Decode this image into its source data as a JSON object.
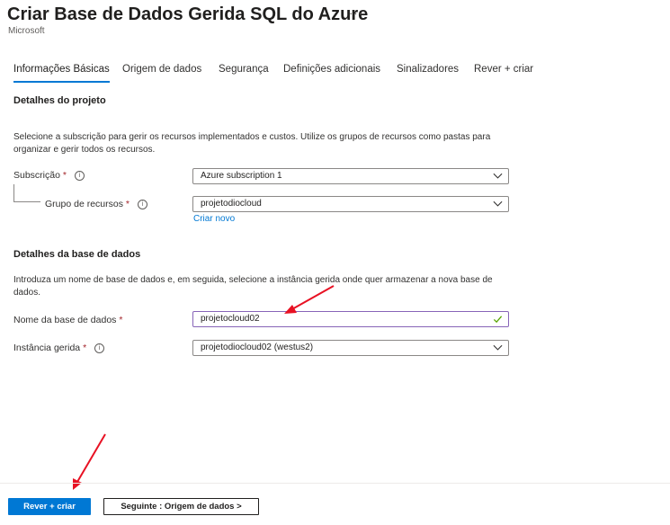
{
  "header": {
    "title": "Criar Base de Dados Gerida SQL do Azure",
    "more": "···",
    "publisher": "Microsoft"
  },
  "tabs": [
    {
      "label": "Informações Básicas",
      "active": true
    },
    {
      "label": "Origem de dados",
      "active": false
    },
    {
      "label": "Segurança",
      "active": false
    },
    {
      "label": "Definições adicionais",
      "active": false
    },
    {
      "label": "Sinalizadores",
      "active": false
    },
    {
      "label": "Rever + criar",
      "active": false
    }
  ],
  "project": {
    "heading": "Detalhes do projeto",
    "description": "Selecione a subscrição para gerir os recursos implementados e custos. Utilize os grupos de recursos como pastas para organizar e gerir todos os recursos.",
    "subscription": {
      "label": "Subscrição",
      "required": "*",
      "info": "i",
      "value": "Azure subscription 1"
    },
    "resource_group": {
      "label": "Grupo de recursos",
      "required": "*",
      "info": "i",
      "value": "projetodiocloud",
      "create_new": "Criar novo"
    }
  },
  "database": {
    "heading": "Detalhes da base de dados",
    "description": "Introduza um nome de base de dados e, em seguida, selecione a instância gerida onde quer armazenar a nova base de dados.",
    "name": {
      "label": "Nome da base de dados",
      "required": "*",
      "value": "projetocloud02"
    },
    "instance": {
      "label": "Instância gerida",
      "required": "*",
      "info": "i",
      "value": "projetodiocloud02 (westus2)"
    }
  },
  "footer": {
    "review_create": "Rever + criar",
    "next": "Seguinte : Origem de dados >"
  },
  "colors": {
    "accent": "#0078d4",
    "required": "#a4262c",
    "valid_check": "#57a300",
    "annotation_arrow": "#e81123"
  }
}
